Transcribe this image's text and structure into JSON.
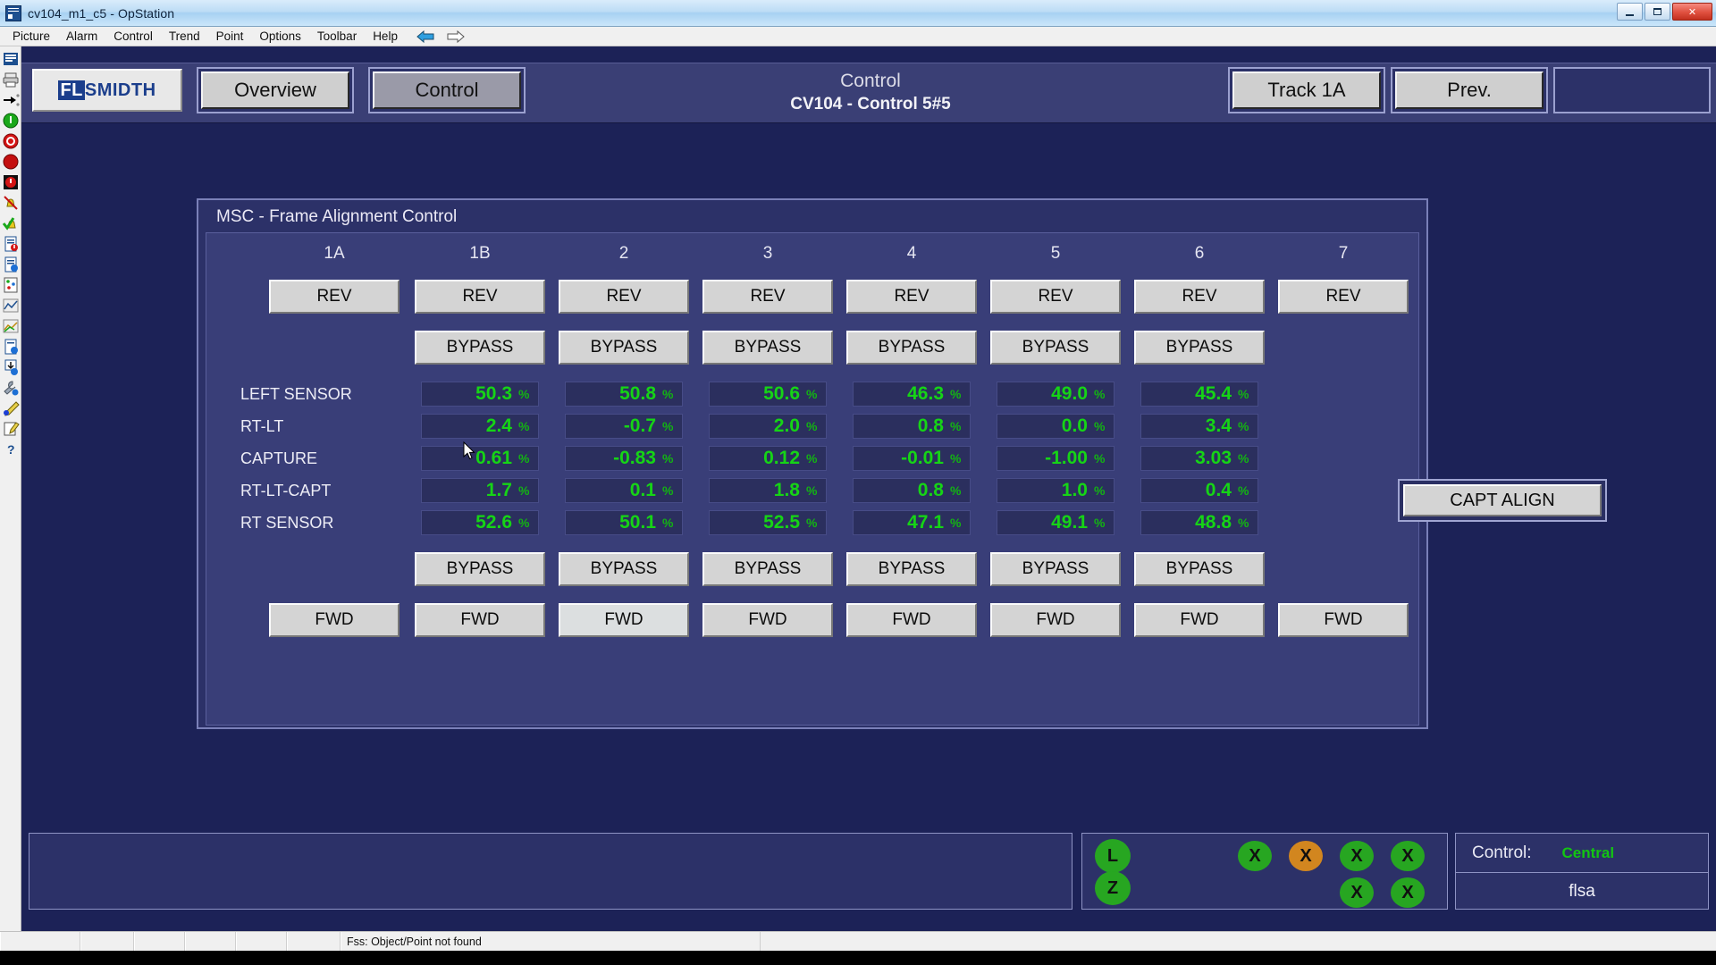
{
  "window": {
    "title": "cv104_m1_c5 - OpStation",
    "icon": "opstation-icon",
    "controls": {
      "minimize": "minimize",
      "maximize": "maximize",
      "close": "close"
    }
  },
  "menu": {
    "items": [
      "Picture",
      "Alarm",
      "Control",
      "Trend",
      "Point",
      "Options",
      "Toolbar",
      "Help"
    ],
    "nav": {
      "back": "back-arrow-icon",
      "forward": "forward-arrow-icon"
    }
  },
  "left_toolbar": {
    "items": [
      "picture-icon",
      "print-icon",
      "jump-icon",
      "start-icon",
      "stop-icon",
      "halt-icon",
      "emergency-icon",
      "alarm-off-icon",
      "alarm-ack-icon",
      "report-alarm-icon",
      "report-info-icon",
      "points-icon",
      "trend-icon",
      "trend-plot-icon",
      "document-info-icon",
      "download-icon",
      "tools-icon",
      "pen-icon",
      "edit-icon",
      "help-icon"
    ]
  },
  "header": {
    "logo": {
      "part1": "FL",
      "part2": "S",
      "part3": "MIDTH",
      "full": "FLSMIDTH"
    },
    "buttons": [
      {
        "label": "Overview",
        "state": "normal"
      },
      {
        "label": "Control",
        "state": "active"
      }
    ],
    "title_line1": "Control",
    "title_line2": "CV104 - Control 5#5",
    "right_buttons": [
      {
        "label": "Track 1A",
        "state": "normal"
      },
      {
        "label": "Prev.",
        "state": "normal"
      },
      {
        "label": "",
        "state": "empty"
      }
    ]
  },
  "groupbox": {
    "title": "MSC - Frame Alignment Control",
    "columns": [
      "1A",
      "1B",
      "2",
      "3",
      "4",
      "5",
      "6",
      "7"
    ],
    "rev_label": "REV",
    "fwd_label": "FWD",
    "bypass_label": "BYPASS",
    "rev_buttons": [
      "REV",
      "REV",
      "REV",
      "REV",
      "REV",
      "REV",
      "REV",
      "REV"
    ],
    "fwd_buttons": [
      "FWD",
      "FWD",
      "FWD",
      "FWD",
      "FWD",
      "FWD",
      "FWD",
      "FWD"
    ],
    "bypass_top": [
      "BYPASS",
      "BYPASS",
      "BYPASS",
      "BYPASS",
      "BYPASS",
      "BYPASS"
    ],
    "bypass_bottom": [
      "BYPASS",
      "BYPASS",
      "BYPASS",
      "BYPASS",
      "BYPASS",
      "BYPASS"
    ],
    "unit": "%",
    "row_labels": [
      "LEFT SENSOR",
      "RT-LT",
      "CAPTURE",
      "RT-LT-CAPT",
      "RT SENSOR"
    ],
    "data_columns": [
      "1B",
      "2",
      "3",
      "4",
      "5",
      "6"
    ],
    "values": {
      "LEFT SENSOR": [
        "50.3",
        "50.8",
        "50.6",
        "46.3",
        "49.0",
        "45.4"
      ],
      "RT-LT": [
        "2.4",
        "-0.7",
        "2.0",
        "0.8",
        "0.0",
        "3.4"
      ],
      "CAPTURE": [
        "0.61",
        "-0.83",
        "0.12",
        "-0.01",
        "-1.00",
        "3.03"
      ],
      "RT-LT-CAPT": [
        "1.7",
        "0.1",
        "1.8",
        "0.8",
        "1.0",
        "0.4"
      ],
      "RT SENSOR": [
        "52.6",
        "50.1",
        "52.5",
        "47.1",
        "49.1",
        "48.8"
      ]
    },
    "capt_align_label": "CAPT ALIGN"
  },
  "bottom": {
    "alarm_banner": "",
    "lamps": [
      {
        "text": "L",
        "color": "green"
      },
      {
        "text": "Z",
        "color": "green"
      },
      {
        "text": "X",
        "color": "green"
      },
      {
        "text": "X",
        "color": "orange"
      },
      {
        "text": "X",
        "color": "green"
      },
      {
        "text": "X",
        "color": "green"
      },
      {
        "text": "X",
        "color": "green"
      },
      {
        "text": "X",
        "color": "green"
      }
    ],
    "control_label": "Control:",
    "control_value": "Central",
    "user": "flsa"
  },
  "statusbar": {
    "message": "Fss: Object/Point not found",
    "cells": 6
  },
  "colors": {
    "canvas_blue": "#1c2257",
    "panel_blue": "#2c3168",
    "inner_blue": "#393e78",
    "value_green": "#16d416",
    "lamp_green": "#27a621",
    "lamp_orange": "#d2861f",
    "button_gray": "#d4d4d4",
    "logo_blue": "#1b3e8c"
  }
}
